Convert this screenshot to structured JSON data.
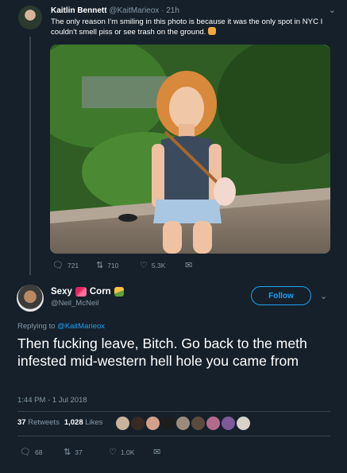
{
  "quoted_tweet": {
    "name": "Kaitlin Bennett",
    "handle": "@KaitMarieox",
    "time": "21h",
    "separator": "·",
    "text": "The only reason I’m smiling in this photo is because it was the only spot in NYC I couldn't smell piss or see trash on the ground.",
    "actions": {
      "replies": "721",
      "retweets": "710",
      "likes": "5.3K"
    }
  },
  "main_tweet": {
    "name": "Sexy",
    "name_suffix": "Corn",
    "handle": "@Neil_McNeil",
    "follow_label": "Follow",
    "replying_prefix": "Replying to",
    "replying_handle": "@KaitMarieox",
    "text": "Then fucking leave, Bitch. Go back to the meth infested mid-western hell hole you came from",
    "timestamp": "1:44 PM - 1 Jul 2018",
    "stats": {
      "retweets_count": "37",
      "retweets_label": "Retweets",
      "likes_count": "1,028",
      "likes_label": "Likes"
    },
    "actions": {
      "replies": "68",
      "retweets": "37",
      "likes": "1.0K"
    }
  },
  "icons": {
    "reply": "reply-icon",
    "retweet": "retweet-icon",
    "like": "heart-icon",
    "dm": "mail-icon",
    "more": "chevron-down-icon"
  },
  "colors": {
    "background": "#15202b",
    "accent": "#1da1f2",
    "muted": "#8899a6",
    "divider": "#38444d"
  }
}
